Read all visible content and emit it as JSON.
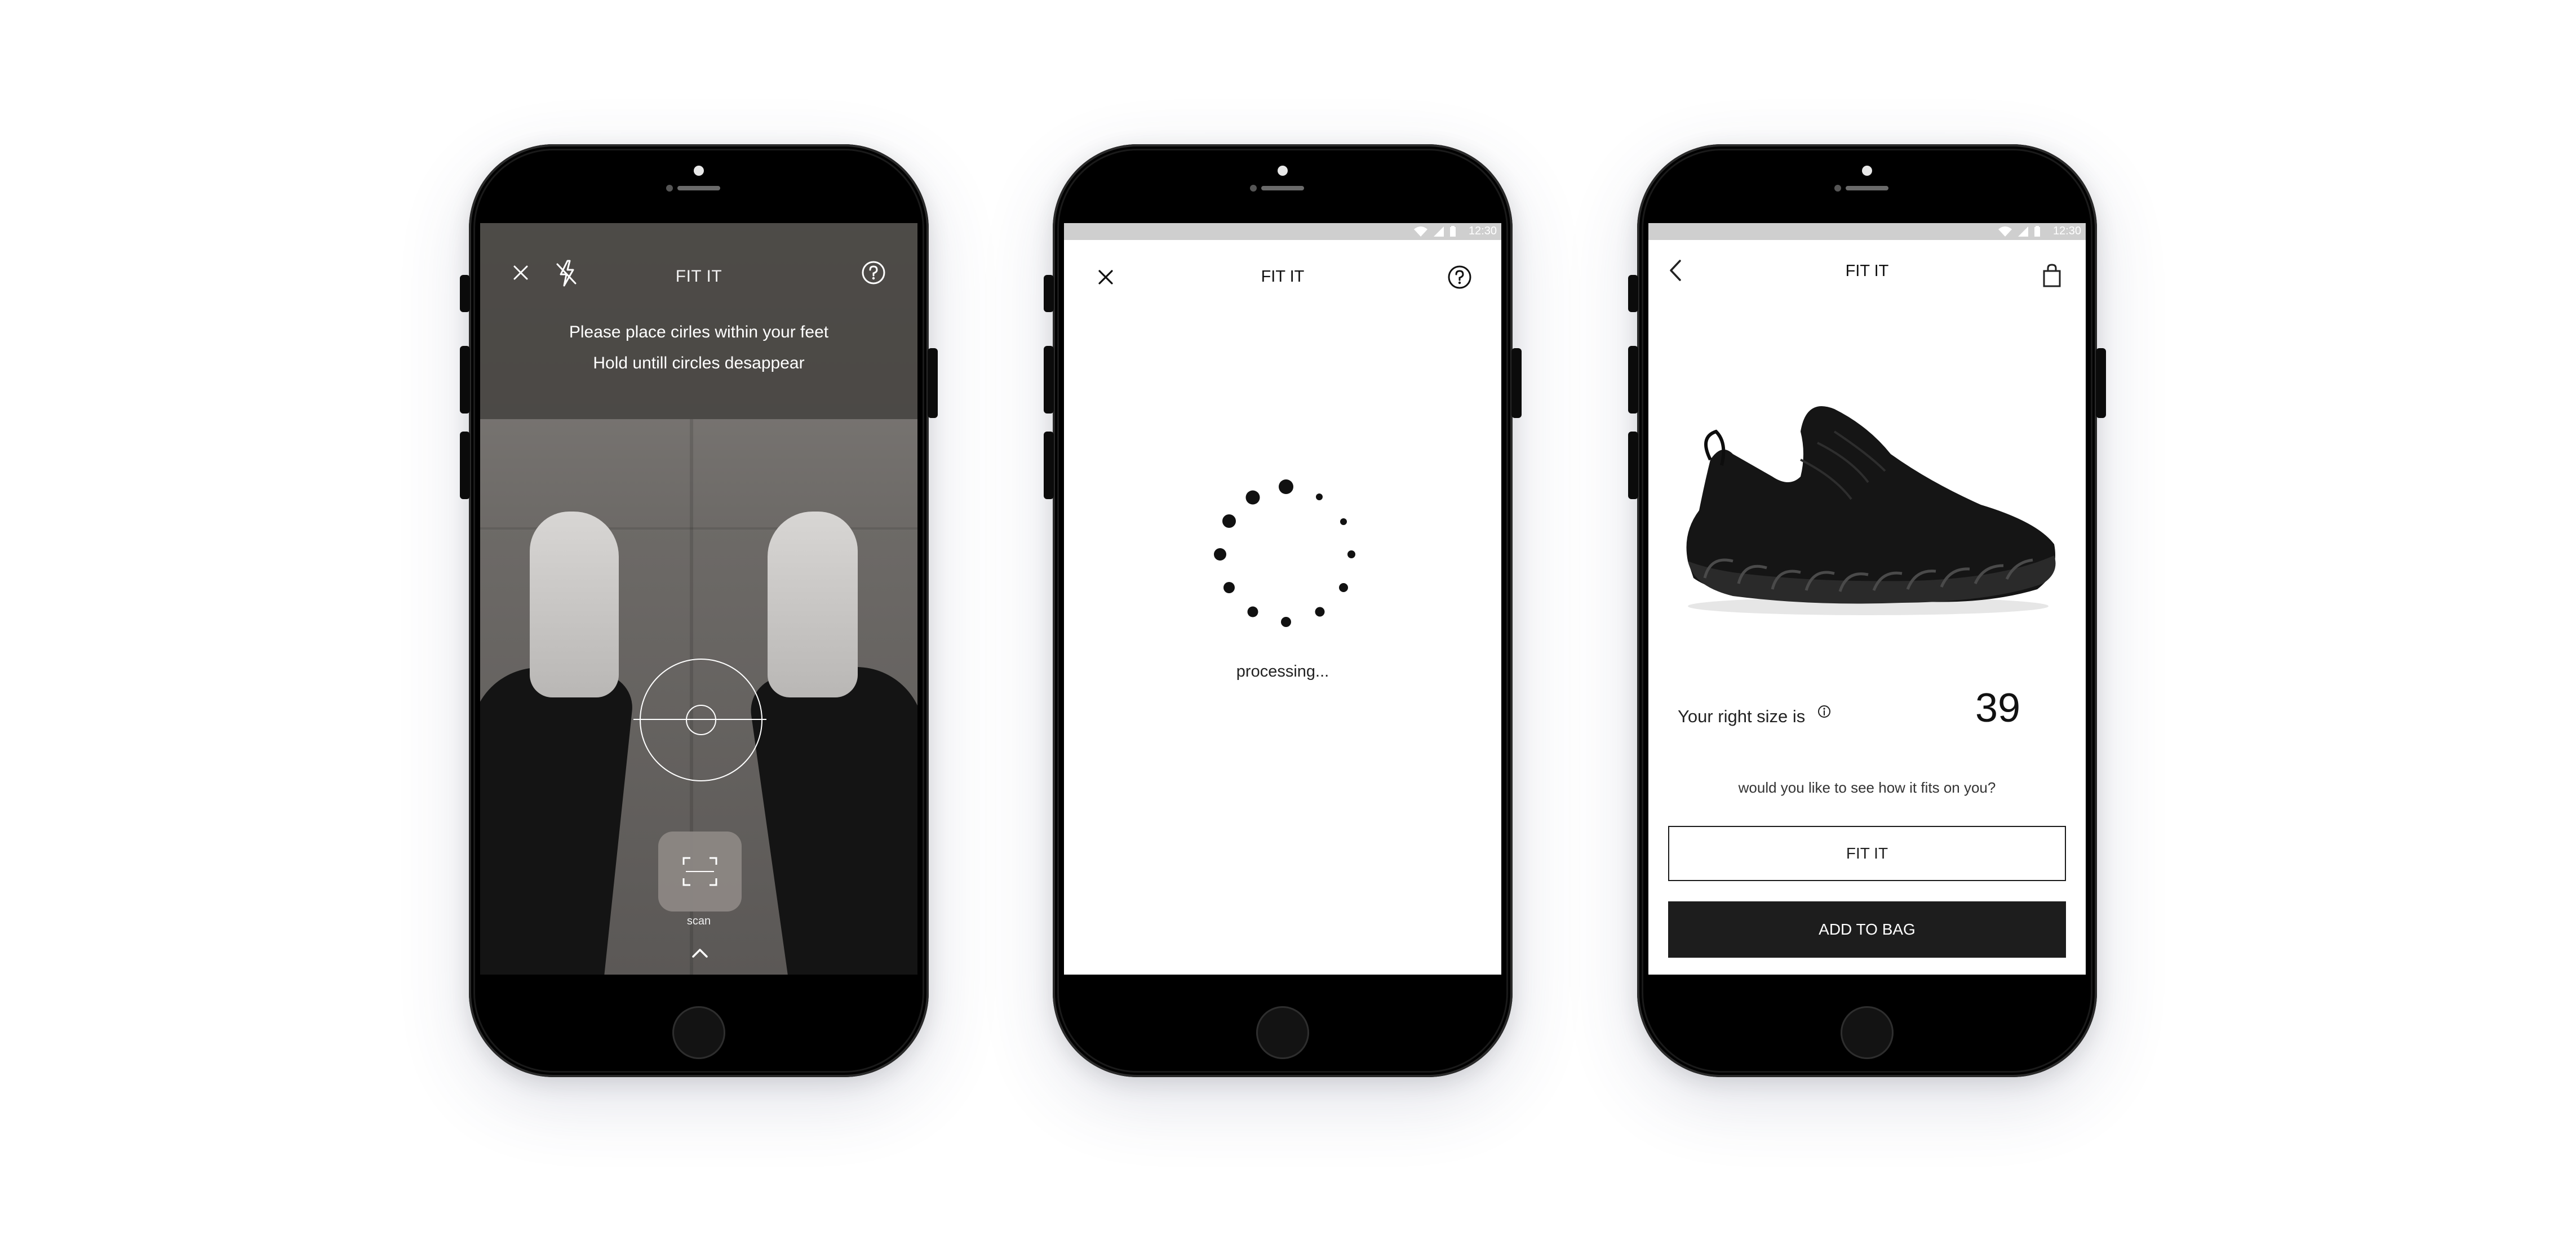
{
  "screens": {
    "camera": {
      "title": "FIT IT",
      "instruction_line1": "Please place cirles within your feet",
      "instruction_line2": "Hold untill circles desappear",
      "scan_label": "scan",
      "icons": [
        "close-icon",
        "flash-off-icon",
        "help-icon",
        "scan-frame-icon",
        "chevron-up-icon"
      ]
    },
    "processing": {
      "status_time": "12:30",
      "title": "FIT IT",
      "processing_text": "processing...",
      "icons": [
        "close-icon",
        "help-icon",
        "loading-spinner"
      ]
    },
    "result": {
      "status_time": "12:30",
      "title": "FIT IT",
      "size_label": "Your right size is",
      "size_value": "39",
      "prompt": "would you like to see how it fits on you?",
      "fit_button": "FIT IT",
      "add_to_bag_button": "ADD TO BAG",
      "icons": [
        "back-chevron-icon",
        "shopping-bag-icon",
        "info-icon"
      ]
    }
  },
  "colors": {
    "button_dark": "#1d1d1d",
    "status_bar": "#cfcfcf",
    "camera_overlay": "#46433f"
  }
}
